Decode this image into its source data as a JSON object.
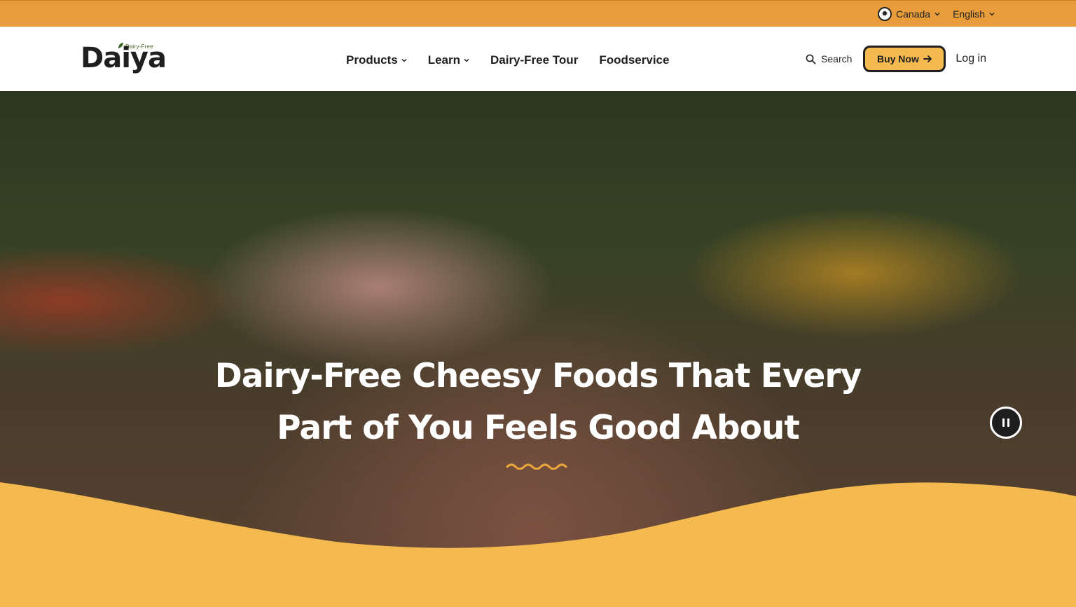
{
  "topbar": {
    "region_label": "Canada",
    "language_label": "English",
    "flag_glyph": "✹"
  },
  "header": {
    "logo_text": "Daiya",
    "logo_tag": "Dairy-Free",
    "nav": [
      {
        "label": "Products",
        "has_dropdown": true
      },
      {
        "label": "Learn",
        "has_dropdown": true
      },
      {
        "label": "Dairy-Free Tour",
        "has_dropdown": false
      },
      {
        "label": "Foodservice",
        "has_dropdown": false
      }
    ],
    "search_label": "Search",
    "buy_label": "Buy Now",
    "login_label": "Log in"
  },
  "hero": {
    "heading_line1": "Dairy-Free Cheesy Foods That Every",
    "heading_line2": "Part of You Feels Good About"
  },
  "colors": {
    "topbar": "#e89c3a",
    "accent": "#f4b94f",
    "text_dark": "#1f1f1f"
  },
  "icons": [
    "canada-flag-icon",
    "chevron-down-icon",
    "search-icon",
    "arrow-right-icon",
    "pause-icon"
  ]
}
